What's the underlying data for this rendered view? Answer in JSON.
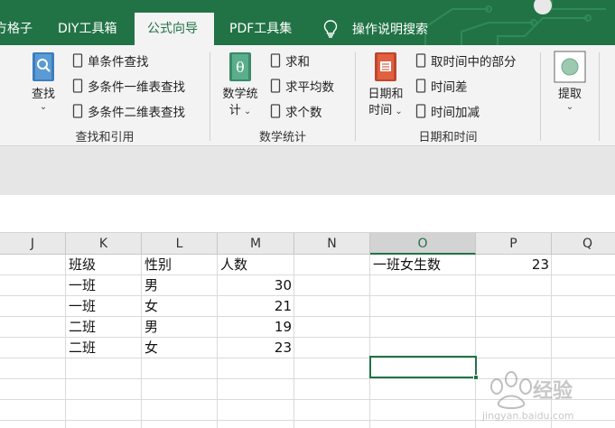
{
  "tabs": [
    {
      "label": "方格子",
      "active": false
    },
    {
      "label": "DIY工具箱",
      "active": false
    },
    {
      "label": "公式向导",
      "active": true
    },
    {
      "label": "PDF工具集",
      "active": false
    }
  ],
  "help_search": "操作说明搜索",
  "ribbon": {
    "lookup": {
      "big_button": "查找",
      "items": [
        "单条件查找",
        "多条件一维表查找",
        "多条件二维表查找"
      ],
      "label": "查找和引用"
    },
    "stats": {
      "big_button_line1": "数学统",
      "big_button_line2": "计",
      "items": [
        "求和",
        "求平均数",
        "求个数"
      ],
      "label": "数学统计"
    },
    "datetime": {
      "big_button_line1": "日期和",
      "big_button_line2": "时间",
      "items": [
        "取时间中的部分",
        "时间差",
        "时间加减"
      ],
      "label": "日期和时间"
    },
    "extract": {
      "big_button": "提取"
    }
  },
  "columns": [
    "J",
    "K",
    "L",
    "M",
    "N",
    "O",
    "P",
    "Q"
  ],
  "selected_column": "O",
  "table": {
    "headers": [
      "班级",
      "性别",
      "人数"
    ],
    "rows": [
      [
        "一班",
        "男",
        "30"
      ],
      [
        "一班",
        "女",
        "21"
      ],
      [
        "二班",
        "男",
        "19"
      ],
      [
        "二班",
        "女",
        "23"
      ]
    ]
  },
  "result": {
    "label": "一班女生数",
    "value": "23"
  },
  "colors": {
    "excel_green": "#217346",
    "ribbon_bg": "#f3f3f3"
  }
}
